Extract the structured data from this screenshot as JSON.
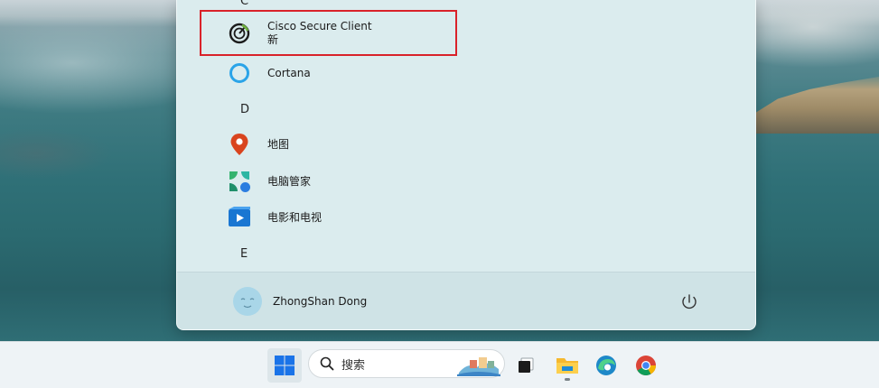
{
  "start_menu": {
    "letters": {
      "c": "C",
      "d": "D",
      "e": "E"
    },
    "apps": [
      {
        "name": "Cisco Secure Client",
        "badge": "新"
      },
      {
        "name": "Cortana"
      },
      {
        "name": "地图"
      },
      {
        "name": "电脑管家"
      },
      {
        "name": "电影和电视"
      }
    ],
    "user": {
      "name": "ZhongShan Dong"
    }
  },
  "taskbar": {
    "search_placeholder": "搜索"
  },
  "colors": {
    "highlight_border": "#d9222a",
    "menu_bg": "#dbecee",
    "taskbar_bg": "#eef3f6"
  }
}
